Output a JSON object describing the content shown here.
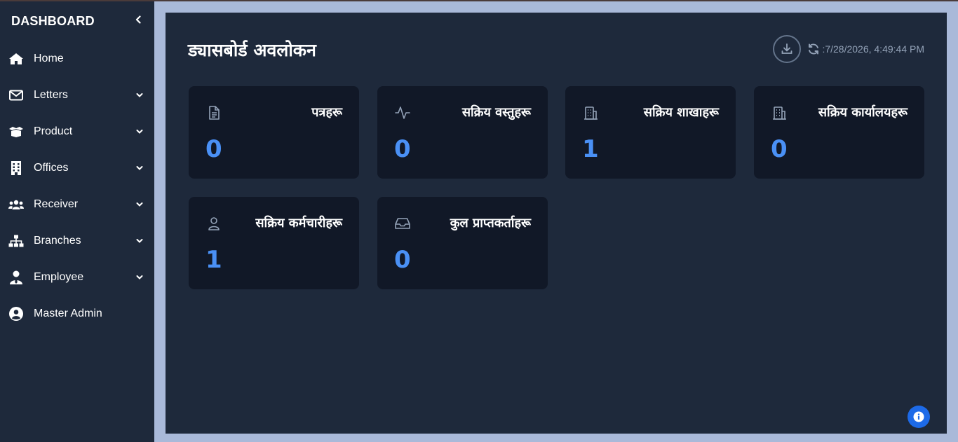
{
  "sidebar": {
    "title": "DASHBOARD",
    "items": [
      {
        "label": "Home",
        "icon": "home-icon",
        "has_submenu": false
      },
      {
        "label": "Letters",
        "icon": "envelope-icon",
        "has_submenu": true
      },
      {
        "label": "Product",
        "icon": "box-icon",
        "has_submenu": true
      },
      {
        "label": "Offices",
        "icon": "building-icon",
        "has_submenu": true
      },
      {
        "label": "Receiver",
        "icon": "users-icon",
        "has_submenu": true
      },
      {
        "label": "Branches",
        "icon": "sitemap-icon",
        "has_submenu": true
      },
      {
        "label": "Employee",
        "icon": "user-tie-icon",
        "has_submenu": true
      },
      {
        "label": "Master Admin",
        "icon": "user-circle-icon",
        "has_submenu": false
      }
    ]
  },
  "header": {
    "title": "ड्यासबोर्ड अवलोकन",
    "timestamp": ":7/28/2026, 4:49:44 PM"
  },
  "cards": [
    {
      "label": "पत्रहरू",
      "value": "0",
      "icon": "document-icon"
    },
    {
      "label": "सक्रिय वस्तुहरू",
      "value": "0",
      "icon": "activity-icon"
    },
    {
      "label": "सक्रिय शाखाहरू",
      "value": "1",
      "icon": "building-icon"
    },
    {
      "label": "सक्रिय कार्यालयहरू",
      "value": "0",
      "icon": "building-icon"
    },
    {
      "label": "सक्रिय कर्मचारीहरू",
      "value": "1",
      "icon": "user-icon"
    },
    {
      "label": "कुल प्राप्तकर्ताहरू",
      "value": "0",
      "icon": "inbox-icon"
    }
  ],
  "colors": {
    "sidebar_bg": "#1e293b",
    "main_bg": "#1e293b",
    "card_bg": "#111827",
    "value_accent": "#4a90f5",
    "frame_bg": "#a9b9d9",
    "fab_bg": "#1d6ae8"
  }
}
